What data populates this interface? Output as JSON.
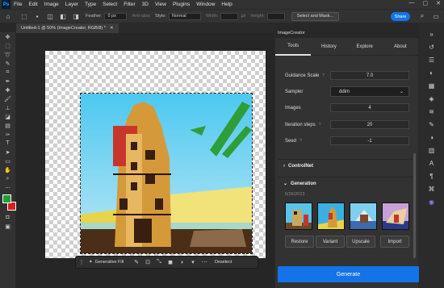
{
  "menubar": {
    "logo": "Ps",
    "items": [
      "File",
      "Edit",
      "Image",
      "Layer",
      "Type",
      "Select",
      "Filter",
      "3D",
      "View",
      "Plugins",
      "Window",
      "Help"
    ],
    "controls": [
      "—",
      "▢",
      "✕"
    ]
  },
  "options": {
    "feather_label": "Feather:",
    "feather_value": "0 px",
    "antialias_label": "Anti-alias",
    "style_label": "Style:",
    "style_value": "Normal",
    "width_label": "Width:",
    "height_label": "Height:",
    "select_mask": "Select and Mask...",
    "share": "Share"
  },
  "document": {
    "tab_title": "Untitled-1 @ 50% (ImageCreator, RGB/8) *",
    "close": "✕"
  },
  "context_bar": {
    "generative_fill": "Generative Fill",
    "deselect": "Deselect"
  },
  "panel": {
    "title": "ImageCreator",
    "tabs": [
      "Tools",
      "History",
      "Explore",
      "About"
    ],
    "active_tab": "Tools",
    "guidance_label": "Guidance Scale",
    "guidance_value": "7.0",
    "sampler_label": "Sampler",
    "sampler_value": "ddim",
    "images_label": "Images",
    "images_value": "4",
    "steps_label": "Iteration steps",
    "steps_value": "20",
    "seed_label": "Seed",
    "seed_value": "-1",
    "help": "?",
    "controlnet": "ControlNet",
    "generation": "Generation",
    "gen_date": "6/26/2023",
    "restore": "Restore",
    "variant": "Variant",
    "upscale": "Upscale",
    "import": "Import",
    "generate": "Generate"
  },
  "colors": {
    "foreground": "#1fa030",
    "background": "#d42020",
    "accent": "#1473e6"
  }
}
